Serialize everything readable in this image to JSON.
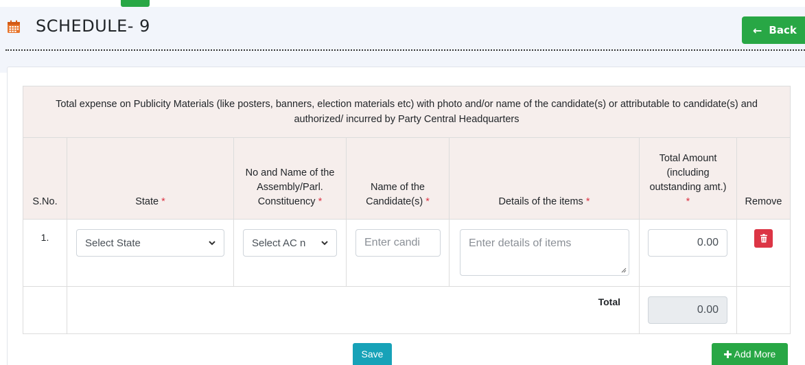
{
  "header": {
    "title": "SCHEDULE- 9",
    "back_label": "Back"
  },
  "table": {
    "caption": "Total expense on Publicity Materials (like posters, banners, election materials etc) with photo and/or name of the candidate(s) or attributable to candidate(s) and authorized/ incurred by Party Central Headquarters",
    "columns": {
      "sno": "S.No.",
      "state": "State",
      "constituency": "No and Name of the Assembly/Parl. Constituency",
      "candidate": "Name of the Candidate(s)",
      "details": "Details of the items",
      "amount": "Total Amount (including outstanding amt.)",
      "remove": "Remove"
    },
    "required_mark": "*",
    "rows": [
      {
        "sno": "1.",
        "state_placeholder": "Select State",
        "ac_placeholder": "Select AC n",
        "candidate_placeholder": "Enter candi",
        "details_placeholder": "Enter details of items",
        "amount": "0.00"
      }
    ],
    "total_label": "Total",
    "total_value": "0.00"
  },
  "actions": {
    "save_label": "Save",
    "add_more_label": "Add More"
  },
  "colors": {
    "green": "#28a745",
    "red": "#dc3545",
    "teal": "#17a2b8",
    "header_bg": "#f6eeec",
    "page_bg": "#f2f5fb"
  }
}
